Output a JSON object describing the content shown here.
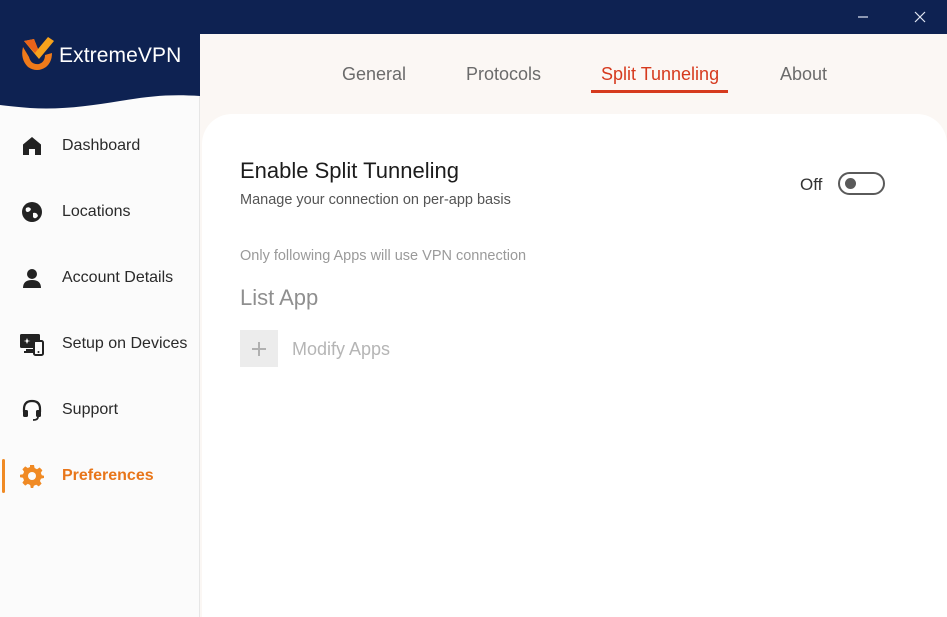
{
  "app": {
    "name": "ExtremeVPN"
  },
  "window": {
    "minimize_icon": "minimize-icon",
    "close_icon": "close-icon"
  },
  "sidebar": {
    "items": [
      {
        "label": "Dashboard",
        "icon": "home-icon",
        "active": false
      },
      {
        "label": "Locations",
        "icon": "globe-icon",
        "active": false
      },
      {
        "label": "Account Details",
        "icon": "user-icon",
        "active": false
      },
      {
        "label": "Setup on Devices",
        "icon": "devices-icon",
        "active": false
      },
      {
        "label": "Support",
        "icon": "headset-icon",
        "active": false
      },
      {
        "label": "Preferences",
        "icon": "gear-icon",
        "active": true
      }
    ]
  },
  "tabs": [
    {
      "label": "General",
      "active": false
    },
    {
      "label": "Protocols",
      "active": false
    },
    {
      "label": "Split Tunneling",
      "active": true
    },
    {
      "label": "About",
      "active": false
    }
  ],
  "split_tunneling": {
    "title": "Enable Split Tunneling",
    "subtitle": "Manage your connection on per-app basis",
    "toggle_label": "Off",
    "enabled": false,
    "info_text": "Only following Apps will use VPN connection",
    "list_title": "List App",
    "modify_label": "Modify Apps"
  },
  "colors": {
    "titlebar": "#0e2252",
    "accent_orange": "#f08a24",
    "tab_active": "#d63a1e"
  }
}
